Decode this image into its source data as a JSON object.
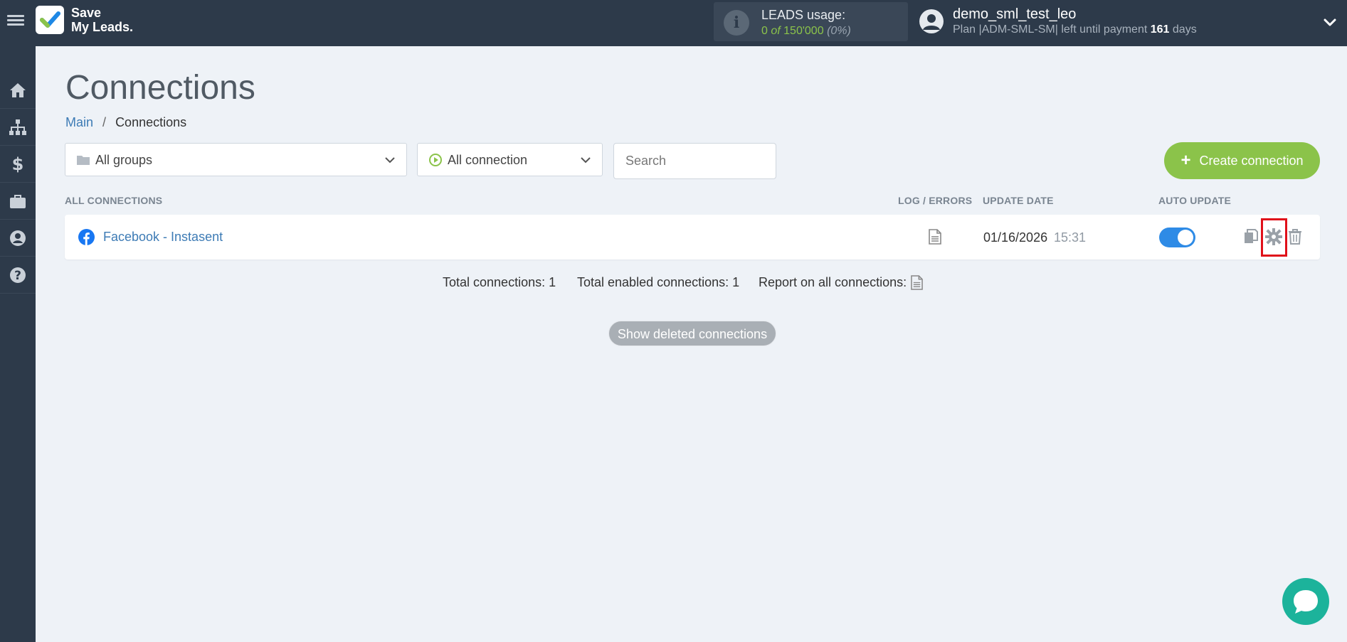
{
  "header": {
    "logo_line1": "Save",
    "logo_line2": "My Leads.",
    "leads_usage_label": "LEADS usage:",
    "leads_used": "0",
    "leads_of": "of",
    "leads_total": "150'000",
    "leads_percent": "(0%)",
    "user_name": "demo_sml_test_leo",
    "plan_prefix": "Plan |ADM-SML-SM| left until payment",
    "plan_days": "161",
    "plan_days_suffix": "days"
  },
  "sidebar": {
    "items": [
      {
        "icon": "home-icon"
      },
      {
        "icon": "sitemap-icon"
      },
      {
        "icon": "dollar-icon"
      },
      {
        "icon": "briefcase-icon"
      },
      {
        "icon": "user-circle-icon"
      },
      {
        "icon": "help-icon"
      }
    ]
  },
  "page": {
    "title": "Connections",
    "breadcrumb_main": "Main",
    "breadcrumb_sep": "/",
    "breadcrumb_current": "Connections"
  },
  "filters": {
    "groups_value": "All groups",
    "status_value": "All connection",
    "search_placeholder": "Search",
    "create_label": "Create connection",
    "create_plus": "+"
  },
  "table": {
    "headers": {
      "all": "ALL CONNECTIONS",
      "log": "LOG / ERRORS",
      "update": "UPDATE DATE",
      "auto": "AUTO UPDATE"
    },
    "rows": [
      {
        "name": "Facebook - Instasent",
        "update_date": "01/16/2026",
        "update_time": "15:31",
        "auto_update": true
      }
    ]
  },
  "totals": {
    "total": "Total connections: 1",
    "enabled": "Total enabled connections: 1",
    "report": "Report on all connections:"
  },
  "show_deleted_label": "Show deleted connections",
  "colors": {
    "topbar": "#2d3a4a",
    "accent_green": "#8bc34a",
    "toggle_blue": "#2e8be6",
    "link_blue": "#3d7bb5",
    "highlight_red": "#e0101a",
    "chat_teal": "#1cb39b"
  }
}
